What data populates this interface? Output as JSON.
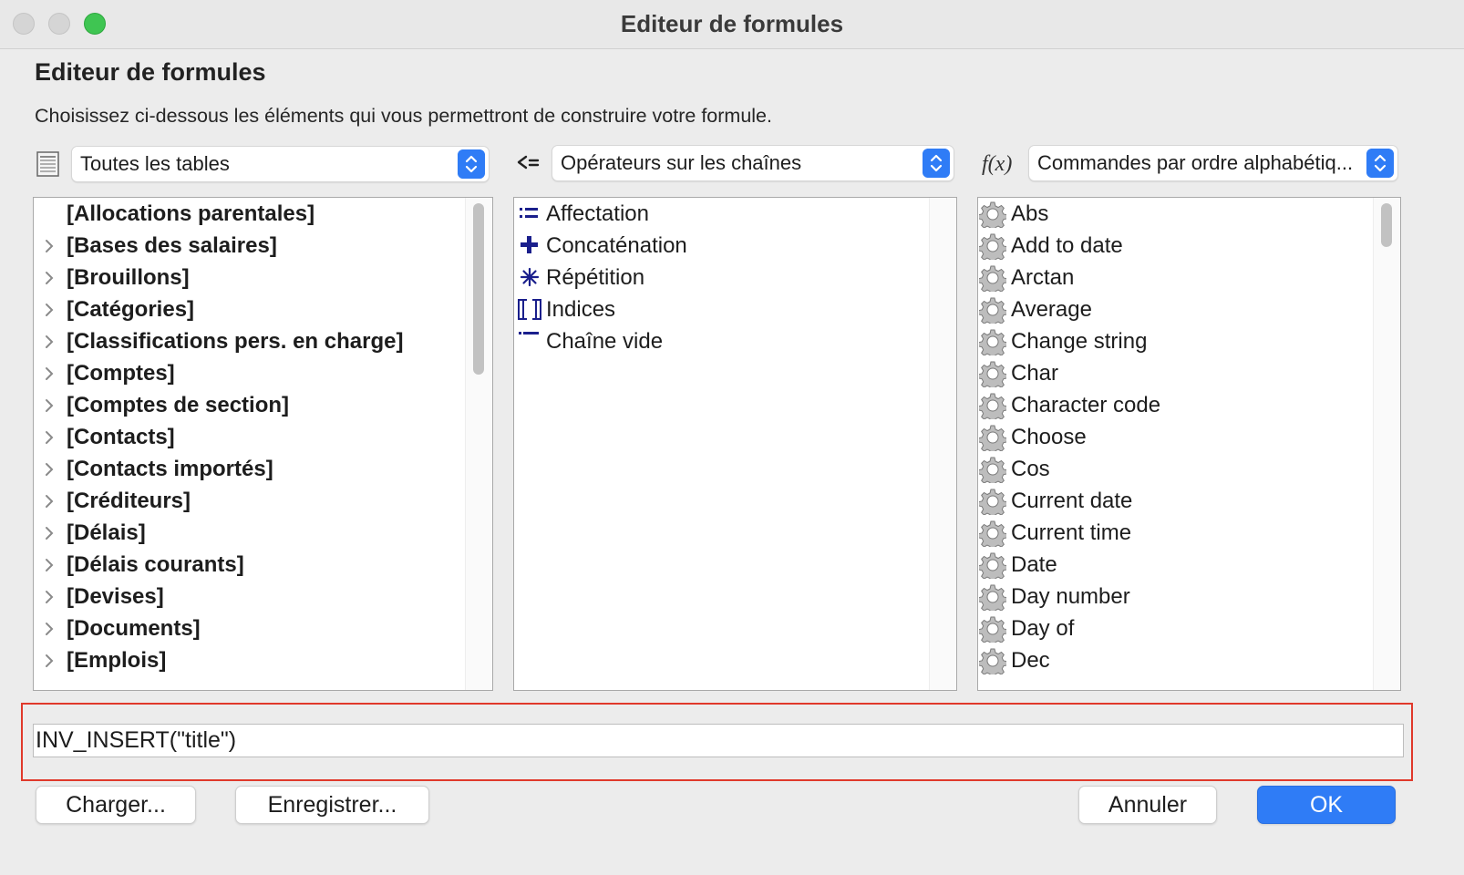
{
  "window": {
    "title": "Editeur de formules"
  },
  "header": {
    "title": "Editeur de formules",
    "subtitle": "Choisissez ci-dessous les éléments qui vous permettront de construire votre formule."
  },
  "tables_panel": {
    "selected": "Toutes les tables",
    "items": [
      "[Allocations parentales]",
      "[Bases des salaires]",
      "[Brouillons]",
      "[Catégories]",
      "[Classifications pers. en charge]",
      "[Comptes]",
      "[Comptes de section]",
      "[Contacts]",
      "[Contacts importés]",
      "[Créditeurs]",
      "[Délais]",
      "[Délais courants]",
      "[Devises]",
      "[Documents]",
      "[Emplois]"
    ]
  },
  "operators_panel": {
    "selected": "Opérateurs sur les chaînes",
    "items": [
      {
        "label": "Affectation",
        "icon": "assignment-icon"
      },
      {
        "label": "Concaténation",
        "icon": "plus-icon"
      },
      {
        "label": "Répétition",
        "icon": "asterisk-icon"
      },
      {
        "label": "Indices",
        "icon": "brackets-icon"
      },
      {
        "label": "Chaîne vide",
        "icon": "empty-string-icon"
      }
    ]
  },
  "commands_panel": {
    "selected": "Commandes par ordre alphabétiq...",
    "items": [
      "Abs",
      "Add to date",
      "Arctan",
      "Average",
      "Change string",
      "Char",
      "Character code",
      "Choose",
      "Cos",
      "Current date",
      "Current time",
      "Date",
      "Day number",
      "Day of",
      "Dec"
    ]
  },
  "formula": {
    "value": "INV_INSERT(\"title\")"
  },
  "buttons": {
    "load": "Charger...",
    "save": "Enregistrer...",
    "cancel": "Annuler",
    "ok": "OK"
  },
  "colors": {
    "accent": "#2f7cf6",
    "highlight_border": "#e0392b",
    "operator_icon": "#1a1f8c"
  }
}
